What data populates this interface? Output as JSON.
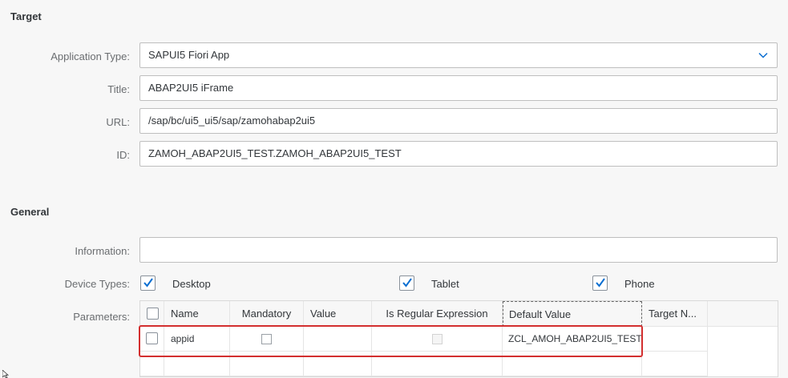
{
  "target": {
    "title": "Target",
    "application_type": {
      "label": "Application Type:",
      "value": "SAPUI5 Fiori App"
    },
    "title_field": {
      "label": "Title:",
      "value": "ABAP2UI5 iFrame"
    },
    "url": {
      "label": "URL:",
      "value": "/sap/bc/ui5_ui5/sap/zamohabap2ui5"
    },
    "id": {
      "label": "ID:",
      "value": "ZAMOH_ABAP2UI5_TEST.ZAMOH_ABAP2UI5_TEST"
    }
  },
  "general": {
    "title": "General",
    "information": {
      "label": "Information:",
      "value": ""
    },
    "device_types": {
      "label": "Device Types:",
      "options": [
        {
          "label": "Desktop",
          "checked": true
        },
        {
          "label": "Tablet",
          "checked": true
        },
        {
          "label": "Phone",
          "checked": true
        }
      ]
    },
    "parameters": {
      "label": "Parameters:",
      "columns": [
        "Name",
        "Mandatory",
        "Value",
        "Is Regular Expression",
        "Default Value",
        "Target N..."
      ],
      "rows": [
        {
          "name": "appid",
          "mandatory": false,
          "value": "",
          "is_regex": false,
          "default_value": "ZCL_AMOH_ABAP2UI5_TEST",
          "target_name": ""
        }
      ]
    }
  },
  "colors": {
    "checkbox_check": "#0a6ed1",
    "highlight": "#d32f2f",
    "text": "#32363a"
  }
}
